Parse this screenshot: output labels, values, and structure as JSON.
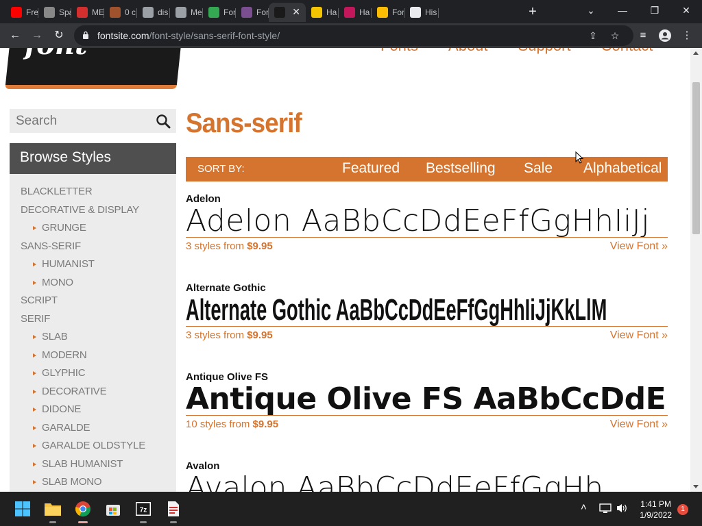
{
  "browser": {
    "tabs": [
      {
        "title": "Fre",
        "favicon": "youtube-icon",
        "color": "#ff0000"
      },
      {
        "title": "Spa",
        "favicon": "spartan-helmet-icon",
        "color": "#888888"
      },
      {
        "title": "ME",
        "favicon": "m-logo-icon",
        "color": "#d32f2f"
      },
      {
        "title": "0 c",
        "favicon": "cookie-icon",
        "color": "#a0522d"
      },
      {
        "title": "dis",
        "favicon": "globe-icon",
        "color": "#9aa0a6"
      },
      {
        "title": "Me",
        "favicon": "globe-icon",
        "color": "#9aa0a6"
      },
      {
        "title": "For",
        "favicon": "maps-pin-icon",
        "color": "#34a853"
      },
      {
        "title": "For",
        "favicon": "mask-icon",
        "color": "#7b4f8f"
      },
      {
        "title": "",
        "favicon": "fontsite-icon",
        "color": "#1a1a1a"
      },
      {
        "title": "Ha",
        "favicon": "if-logo-icon",
        "color": "#f5c400"
      },
      {
        "title": "Ha",
        "favicon": "f-logo-icon",
        "color": "#c2185b"
      },
      {
        "title": "For",
        "favicon": "yellow-square-icon",
        "color": "#fbbc04"
      },
      {
        "title": "His",
        "favicon": "history-icon",
        "color": "#e8eaed"
      }
    ],
    "url_host": "fontsite.com",
    "url_path": "/font-style/sans-serif-font-style/"
  },
  "site": {
    "nav": [
      "Fonts",
      "About",
      "Support",
      "Contact"
    ],
    "search_placeholder": "Search",
    "browse_title": "Browse Styles",
    "categories": [
      {
        "label": "BLACKLETTER",
        "level": 1
      },
      {
        "label": "DECORATIVE & DISPLAY",
        "level": 1
      },
      {
        "label": "GRUNGE",
        "level": 2
      },
      {
        "label": "SANS-SERIF",
        "level": 1
      },
      {
        "label": "HUMANIST",
        "level": 2
      },
      {
        "label": "MONO",
        "level": 2
      },
      {
        "label": "SCRIPT",
        "level": 1
      },
      {
        "label": "SERIF",
        "level": 1
      },
      {
        "label": "SLAB",
        "level": 2
      },
      {
        "label": "MODERN",
        "level": 2
      },
      {
        "label": "GLYPHIC",
        "level": 2
      },
      {
        "label": "DECORATIVE",
        "level": 2
      },
      {
        "label": "DIDONE",
        "level": 2
      },
      {
        "label": "GARALDE",
        "level": 2
      },
      {
        "label": "GARALDE OLDSTYLE",
        "level": 2
      },
      {
        "label": "SLAB HUMANIST",
        "level": 2
      },
      {
        "label": "SLAB MONO",
        "level": 2
      }
    ],
    "page_title": "Sans-serif",
    "sort_label": "SORT BY:",
    "sort_options": [
      "Featured",
      "Bestselling",
      "Sale",
      "Alphabetical"
    ],
    "fonts": [
      {
        "name": "Adelon",
        "sample": "Adelon AaBbCcDdEeFfGgHhIiJj",
        "styles_text": "3 styles from",
        "price": "$9.95",
        "view": "View Font »"
      },
      {
        "name": "Alternate Gothic",
        "sample": "Alternate Gothic AaBbCcDdEeFfGgHhIiJjKkLlM",
        "styles_text": "3 styles from",
        "price": "$9.95",
        "view": "View Font »"
      },
      {
        "name": "Antique Olive FS",
        "sample": "Antique Olive FS AaBbCcDdE",
        "styles_text": "10 styles from",
        "price": "$9.95",
        "view": "View Font »"
      },
      {
        "name": "Avalon",
        "sample": "Avalon AaBbCcDdEeFfGgHh",
        "styles_text": "",
        "price": "",
        "view": ""
      }
    ],
    "accent_color": "#d4742f"
  },
  "taskbar": {
    "time": "1:41 PM",
    "date": "1/9/2022",
    "notification_count": "1"
  }
}
